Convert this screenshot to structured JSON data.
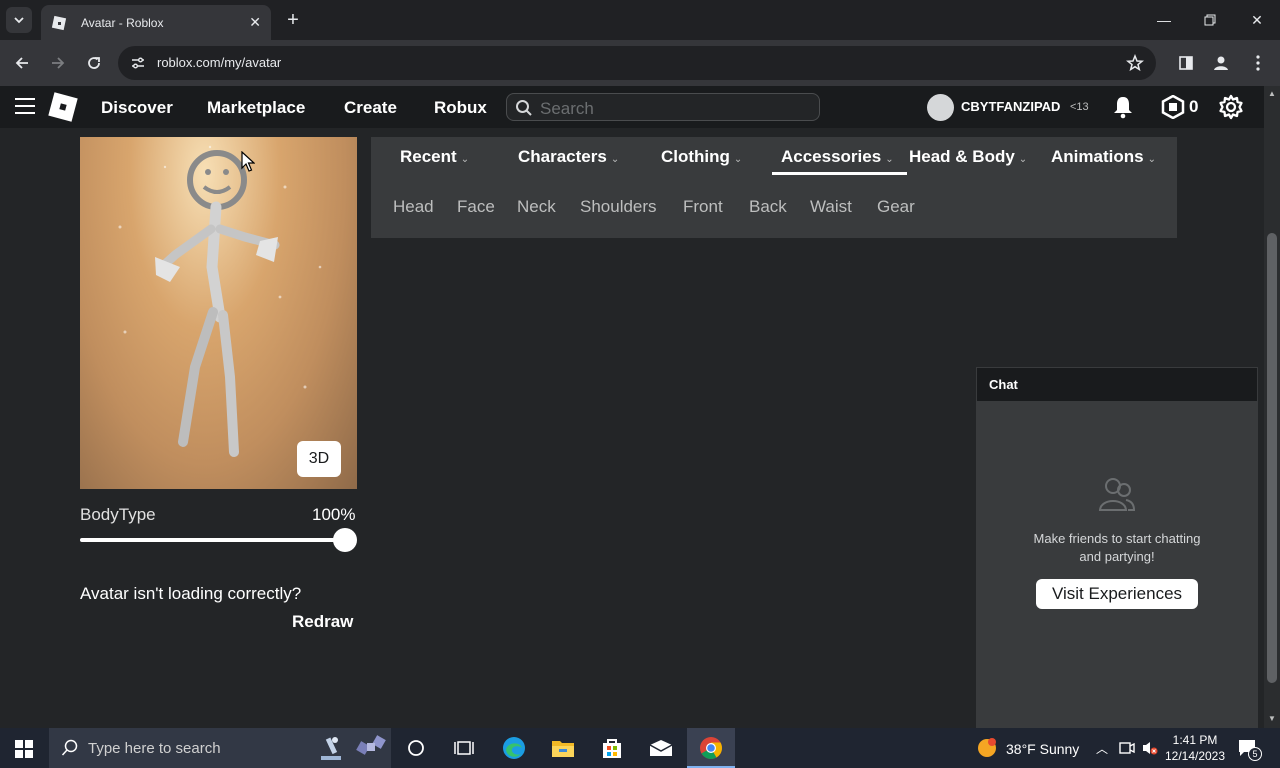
{
  "browser": {
    "tab_title": "Avatar - Roblox",
    "url": "roblox.com/my/avatar"
  },
  "nav": {
    "links": [
      "Discover",
      "Marketplace",
      "Create",
      "Robux"
    ],
    "search_placeholder": "Search",
    "username": "CBYTFANZIPAD",
    "age_label": "<13",
    "robux": "0"
  },
  "avatar": {
    "view_mode": "3D",
    "bodytype_label": "BodyType",
    "bodytype_value": "100%",
    "bodytype_level": 1.0,
    "loading_question": "Avatar isn't loading correctly?",
    "redraw_label": "Redraw"
  },
  "categories": {
    "tabs": [
      "Recent",
      "Characters",
      "Clothing",
      "Accessories",
      "Head & Body",
      "Animations"
    ],
    "active_tab": "Accessories",
    "subtabs": [
      "Head",
      "Face",
      "Neck",
      "Shoulders",
      "Front",
      "Back",
      "Waist",
      "Gear"
    ]
  },
  "chat": {
    "title": "Chat",
    "message_line1": "Make friends to start chatting",
    "message_line2": "and partying!",
    "button_label": "Visit Experiences"
  },
  "taskbar": {
    "search_placeholder": "Type here to search",
    "weather": "38°F  Sunny",
    "time": "1:41 PM",
    "date": "12/14/2023",
    "notification_count": "5"
  }
}
